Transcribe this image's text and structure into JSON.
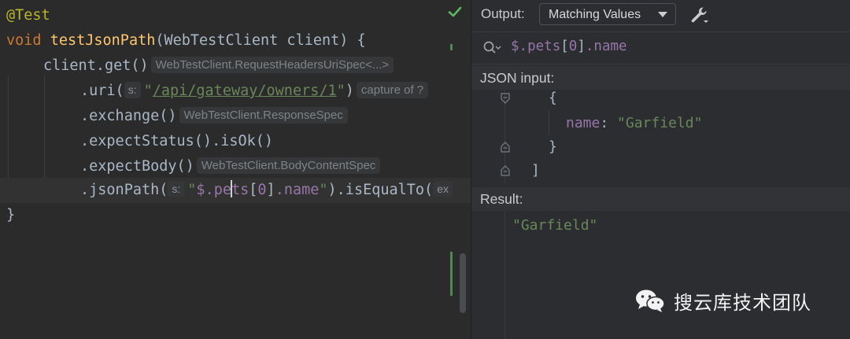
{
  "editor": {
    "line1": {
      "annotation": "@Test"
    },
    "line2": {
      "kw": "void",
      "method": "testJsonPath",
      "rest": "(WebTestClient client) {"
    },
    "line3": {
      "code": "client.get()",
      "hint": "WebTestClient.RequestHeadersUriSpec<...>"
    },
    "line4": {
      "open": ".uri(",
      "param_hint": "s:",
      "q1": "\"",
      "url": "/api/gateway/owners/1",
      "q2": "\"",
      "close": ")",
      "hint": "capture of ?"
    },
    "line5": {
      "code": ".exchange()",
      "hint": "WebTestClient.ResponseSpec"
    },
    "line6": {
      "code": ".expectStatus().isOk()"
    },
    "line7": {
      "code": ".expectBody()",
      "hint": "WebTestClient.BodyContentSpec"
    },
    "line8": {
      "open": ".jsonPath(",
      "param_hint": "s:",
      "q1": "\"",
      "dollar": "$",
      "p1": ".pe",
      "p2": "ts",
      "lb": "[",
      "idx": "0",
      "rb": "]",
      "name": ".name",
      "q2": "\"",
      "rest": ").isEqualTo(",
      "tail_hint": "ex"
    },
    "line9": {
      "code": "}"
    }
  },
  "panel": {
    "output_label": "Output:",
    "dropdown_value": "Matching Values",
    "query": {
      "dollar": "$",
      "p1": ".pets",
      "lb": "[",
      "idx": "0",
      "rb": "]",
      "name": ".name"
    },
    "json_input_label": "JSON input:",
    "json": {
      "open_brace": "{",
      "key": "name",
      "colon": ": ",
      "value": "\"Garfield\"",
      "close_brace": "}",
      "close_bracket": "]"
    },
    "result_label": "Result:",
    "result_value": "\"Garfield\""
  },
  "watermark": {
    "text": "搜云库技术团队"
  },
  "icons": {
    "check": "checkmark-icon",
    "wrench": "wrench-icon",
    "search": "search-icon",
    "chevron": "chevron-down-icon",
    "fold": "fold-icon",
    "wechat": "wechat-icon"
  },
  "colors": {
    "editor_bg": "#2b2b2b",
    "keyword": "#cc7832",
    "annotation": "#bbb529",
    "method": "#ffc66d",
    "string": "#6a8759",
    "jsonpath": "#9876aa",
    "check": "#5fb85f"
  }
}
